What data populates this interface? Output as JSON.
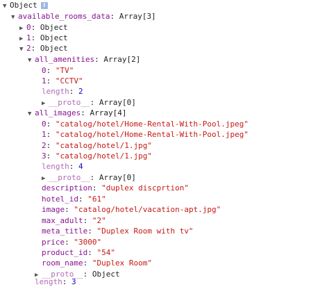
{
  "root": {
    "toggle": "▼",
    "label": "Object",
    "info_glyph": "i"
  },
  "available_rooms": {
    "toggle": "▼",
    "key": "available_rooms_data",
    "sep": ": ",
    "type": "Array[3]",
    "items": [
      {
        "toggle": "▶",
        "index": "0",
        "sep": ": ",
        "value": "Object"
      },
      {
        "toggle": "▶",
        "index": "1",
        "sep": ": ",
        "value": "Object"
      },
      {
        "toggle": "▼",
        "index": "2",
        "sep": ": ",
        "value": "Object"
      }
    ]
  },
  "room": {
    "all_amenities": {
      "toggle": "▼",
      "key": "all_amenities",
      "sep": ": ",
      "type": "Array[2]",
      "items": [
        {
          "index": "0",
          "sep": ": ",
          "value": "\"TV\""
        },
        {
          "index": "1",
          "sep": ": ",
          "value": "\"CCTV\""
        }
      ],
      "length_key": "length",
      "length_sep": ": ",
      "length_value": "2",
      "proto_toggle": "▶",
      "proto_key": "__proto__",
      "proto_sep": ": ",
      "proto_value": "Array[0]"
    },
    "all_images": {
      "toggle": "▼",
      "key": "all_images",
      "sep": ": ",
      "type": "Array[4]",
      "items": [
        {
          "index": "0",
          "sep": ": ",
          "value": "\"catalog/hotel/Home-Rental-With-Pool.jpeg\""
        },
        {
          "index": "1",
          "sep": ": ",
          "value": "\"catalog/hotel/Home-Rental-With-Pool.jpeg\""
        },
        {
          "index": "2",
          "sep": ": ",
          "value": "\"catalog/hotel/1.jpg\""
        },
        {
          "index": "3",
          "sep": ": ",
          "value": "\"catalog/hotel/1.jpg\""
        }
      ],
      "length_key": "length",
      "length_sep": ": ",
      "length_value": "4",
      "proto_toggle": "▶",
      "proto_key": "__proto__",
      "proto_sep": ": ",
      "proto_value": "Array[0]"
    },
    "fields": [
      {
        "key": "description",
        "sep": ": ",
        "value": "\"duplex discprtion\""
      },
      {
        "key": "hotel_id",
        "sep": ": ",
        "value": "\"61\""
      },
      {
        "key": "image",
        "sep": ": ",
        "value": "\"catalog/hotel/vacation-apt.jpg\""
      },
      {
        "key": "max_adult",
        "sep": ": ",
        "value": "\"2\""
      },
      {
        "key": "meta_title",
        "sep": ": ",
        "value": "\"Duplex Room with tv\""
      },
      {
        "key": "price",
        "sep": ": ",
        "value": "\"3000\""
      },
      {
        "key": "product_id",
        "sep": ": ",
        "value": "\"54\""
      },
      {
        "key": "room_name",
        "sep": ": ",
        "value": "\"Duplex Room\""
      }
    ],
    "proto_toggle": "▶",
    "proto_key": "__proto__",
    "proto_sep": ": ",
    "proto_value": "Object"
  },
  "outer_length": {
    "key": "length",
    "sep": ": ",
    "value": "3"
  },
  "colors": {
    "key": "#881391",
    "faded_key": "#b26bb6",
    "string": "#c41a16",
    "number": "#1c00cf",
    "text": "#222222",
    "badge": "#9fb8e0"
  }
}
